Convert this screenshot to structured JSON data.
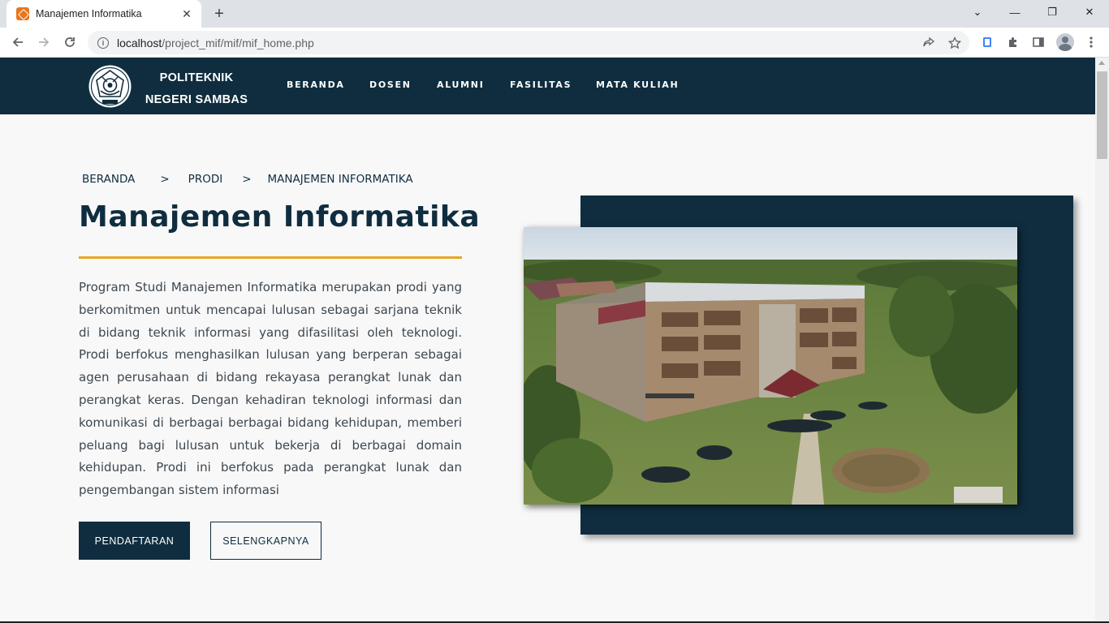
{
  "browser": {
    "tab_title": "Manajemen Informatika",
    "tab_close": "✕",
    "new_tab": "+",
    "url_host": "localhost",
    "url_path": "/project_mif/mif/mif_home.php",
    "window_controls": [
      "⌄",
      "—",
      "❐",
      "✕"
    ]
  },
  "site": {
    "brand_line1": "POLITEKNIK",
    "brand_line2": "NEGERI SAMBAS",
    "menu": [
      "BERANDA",
      "DOSEN",
      "ALUMNI",
      "FASILITAS",
      "MATA KULIAH"
    ]
  },
  "breadcrumb": [
    "BERANDA",
    ">",
    "PRODI",
    ">",
    "MANAJEMEN INFORMATIKA"
  ],
  "hero": {
    "title": "Manajemen Informatika",
    "description": "Program Studi Manajemen Informatika merupakan prodi yang berkomitmen untuk mencapai lulusan sebagai sarjana teknik di bidang teknik informasi yang difasilitasi oleh teknologi. Prodi berfokus menghasilkan lulusan yang berperan sebagai agen perusahaan di bidang rekayasa perangkat lunak dan perangkat keras. Dengan kehadiran teknologi informasi dan komunikasi di berbagai berbagai bidang kehidupan, memberi peluang bagi lulusan untuk bekerja di berbagai domain kehidupan. Prodi ini berfokus pada perangkat lunak dan pengembangan sistem informasi",
    "primary_button": "PENDAFTARAN",
    "secondary_button": "SELENGKAPNYA"
  },
  "colors": {
    "navy": "#0f2d3f",
    "accent": "#e8a622",
    "page_bg": "#f8f8f8"
  }
}
